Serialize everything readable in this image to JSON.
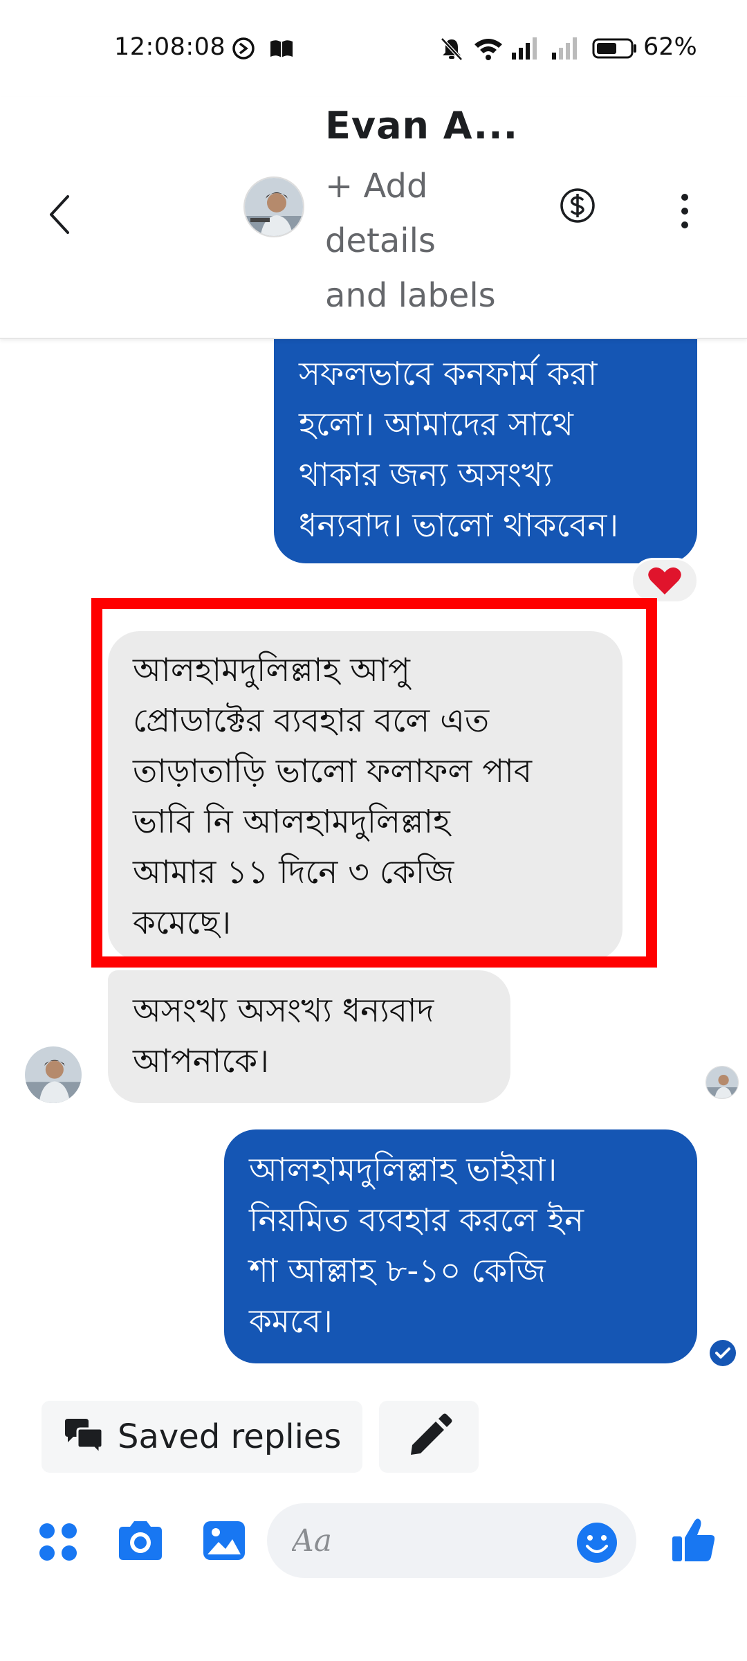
{
  "status_bar": {
    "time": "12:08:08",
    "battery_percent": "62%"
  },
  "header": {
    "contact_name": "Evan A...",
    "subtitle_lines": [
      "+ Add",
      "details",
      "and labels"
    ]
  },
  "messages": [
    {
      "direction": "outgoing",
      "lines": [
        "সফলভাবে কনফার্ম করা",
        "হলো। আমাদের সাথে",
        "থাকার জন্য অসংখ্য",
        "ধন্যবাদ। ভালো থাকবেন।"
      ],
      "reaction": "heart"
    },
    {
      "direction": "incoming",
      "highlighted": true,
      "lines": [
        "আলহামদুলিল্লাহ আপু",
        "প্রোডাক্টের ব্যবহার বলে এত",
        "তাড়াতাড়ি ভালো ফলাফল পাব",
        "ভাবি নি আলহামদুলিল্লাহ",
        "আমার ১১ দিনে ৩ কেজি",
        "কমেছে।"
      ]
    },
    {
      "direction": "incoming",
      "lines": [
        "অসংখ্য অসংখ্য ধন্যবাদ",
        "আপনাকে।"
      ]
    },
    {
      "direction": "outgoing",
      "lines": [
        "আলহামদুলিল্লাহ ভাইয়া।",
        "নিয়মিত ব্যবহার করলে ইন",
        "শা আল্লাহ ৮-১০ কেজি",
        "কমবে।"
      ],
      "status": "delivered"
    }
  ],
  "quick_actions": {
    "saved_replies_label": "Saved replies"
  },
  "composer": {
    "placeholder": "Aa"
  },
  "colors": {
    "accent": "#1556b4",
    "incoming_bubble": "#ebebeb",
    "highlight": "#ff0000",
    "icon_blue": "#1877f2"
  }
}
